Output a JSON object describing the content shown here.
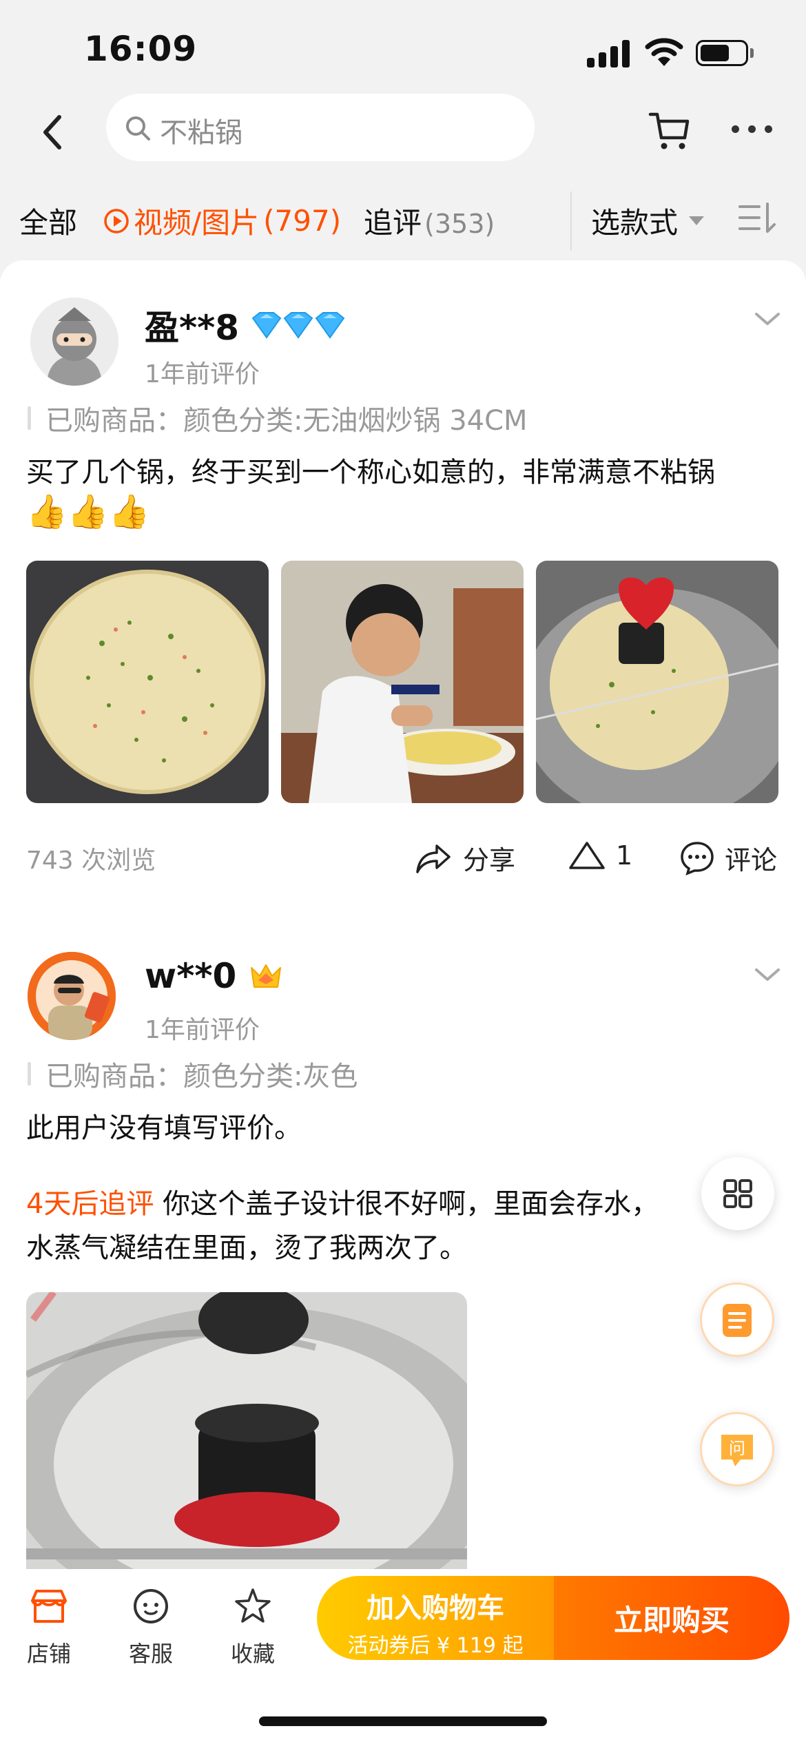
{
  "status": {
    "time": "16:09"
  },
  "search": {
    "query": "不粘锅"
  },
  "tabs": {
    "all": "全部",
    "media_label": "视频/图片",
    "media_count": "(797)",
    "followup_label": "追评",
    "followup_count": "(353)",
    "style_select": "选款式"
  },
  "reviews": [
    {
      "username": "盈**8",
      "time": "1年前评价",
      "purchased": "已购商品：颜色分类:无油烟炒锅 34CM",
      "text": "买了几个锅，终于买到一个称心如意的，非常满意不粘锅",
      "emoji": "👍👍👍",
      "views": "743 次浏览",
      "share": "分享",
      "likes": "1",
      "comment": "评论"
    },
    {
      "username": "w**0",
      "time": "1年前评价",
      "purchased": "已购商品：颜色分类:灰色",
      "text": "此用户没有填写评价。",
      "followup_tag": "4天后追评",
      "followup_text_1": "你这个盖子设计很不好啊，里面会存水，",
      "followup_text_2": "水蒸气凝结在里面，烫了我两次了。"
    }
  ],
  "bottom_bar": {
    "store": "店铺",
    "service": "客服",
    "favorite": "收藏",
    "add_cart": "加入购物车",
    "coupon_price": "活动券后 ¥ 119 起",
    "buy_now": "立即购买"
  },
  "colors": {
    "accent": "#ff5000",
    "cart_gradient": "#ffb000",
    "buy_gradient": "#ff5a00"
  }
}
